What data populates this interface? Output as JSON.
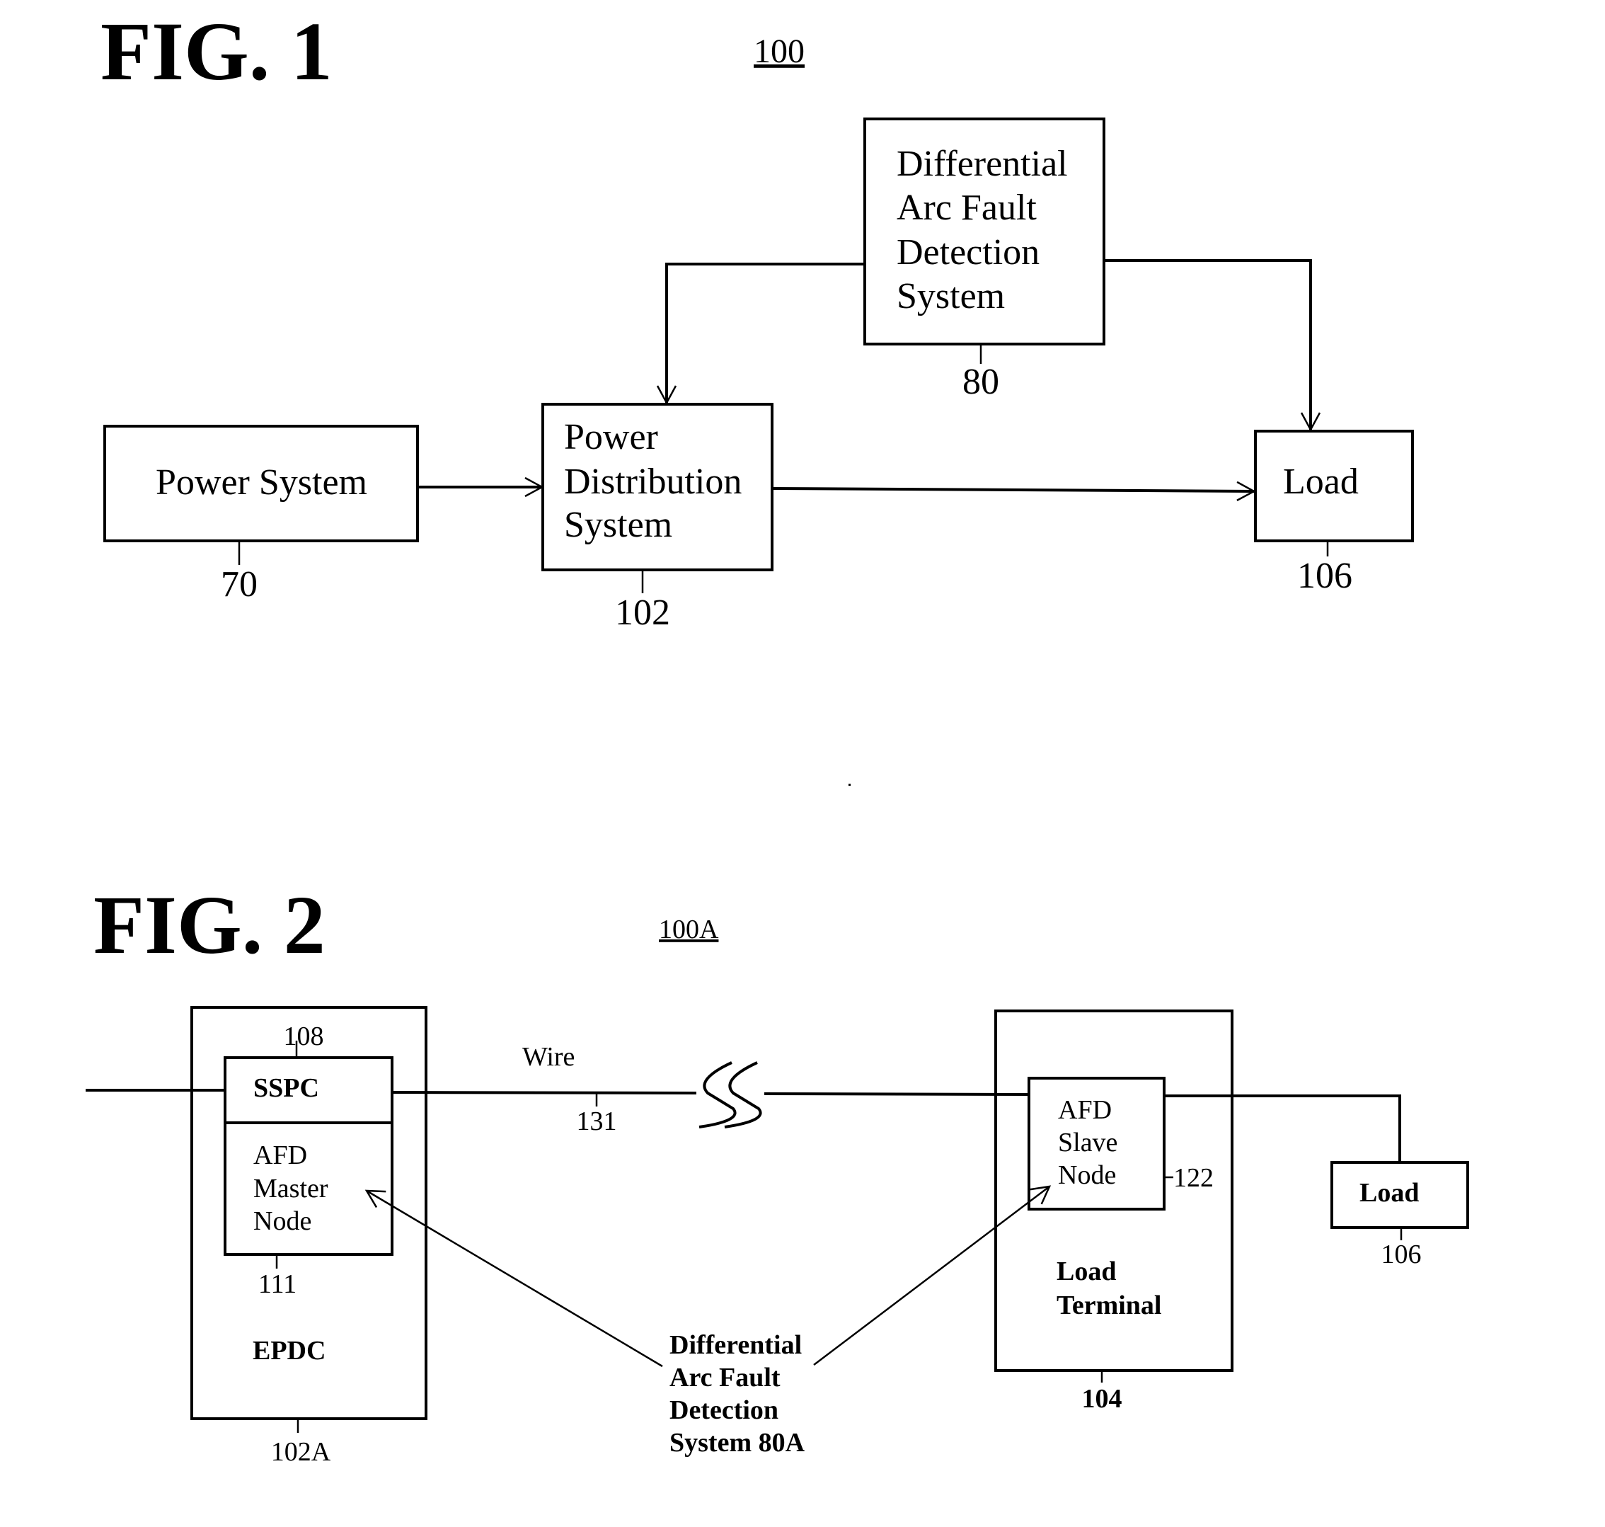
{
  "fig1": {
    "title": "FIG. 1",
    "ref": "100",
    "blocks": {
      "power_system": {
        "lines": [
          "Power System"
        ],
        "ref": "70"
      },
      "power_distribution": {
        "lines": [
          "Power",
          "Distribution",
          "System"
        ],
        "ref": "102"
      },
      "dafd": {
        "lines": [
          "Differential",
          "Arc Fault",
          "Detection",
          "System"
        ],
        "ref": "80"
      },
      "load": {
        "lines": [
          "Load"
        ],
        "ref": "106"
      }
    }
  },
  "fig2": {
    "title": "FIG. 2",
    "ref": "100A",
    "epdc": {
      "label": "EPDC",
      "ref": "102A"
    },
    "sspc": {
      "label": "SSPC",
      "ref": "108"
    },
    "afd_master": {
      "lines": [
        "AFD",
        "Master",
        "Node"
      ],
      "ref": "111"
    },
    "wire": {
      "label": "Wire",
      "ref": "131"
    },
    "load_terminal": {
      "lines": [
        "Load",
        "Terminal"
      ],
      "ref": "104"
    },
    "afd_slave": {
      "lines": [
        "AFD",
        "Slave",
        "Node"
      ],
      "ref": "122"
    },
    "load": {
      "label": "Load",
      "ref": "106"
    },
    "dafd": {
      "lines": [
        "Differential",
        "Arc Fault",
        "Detection",
        "System 80A"
      ]
    }
  }
}
